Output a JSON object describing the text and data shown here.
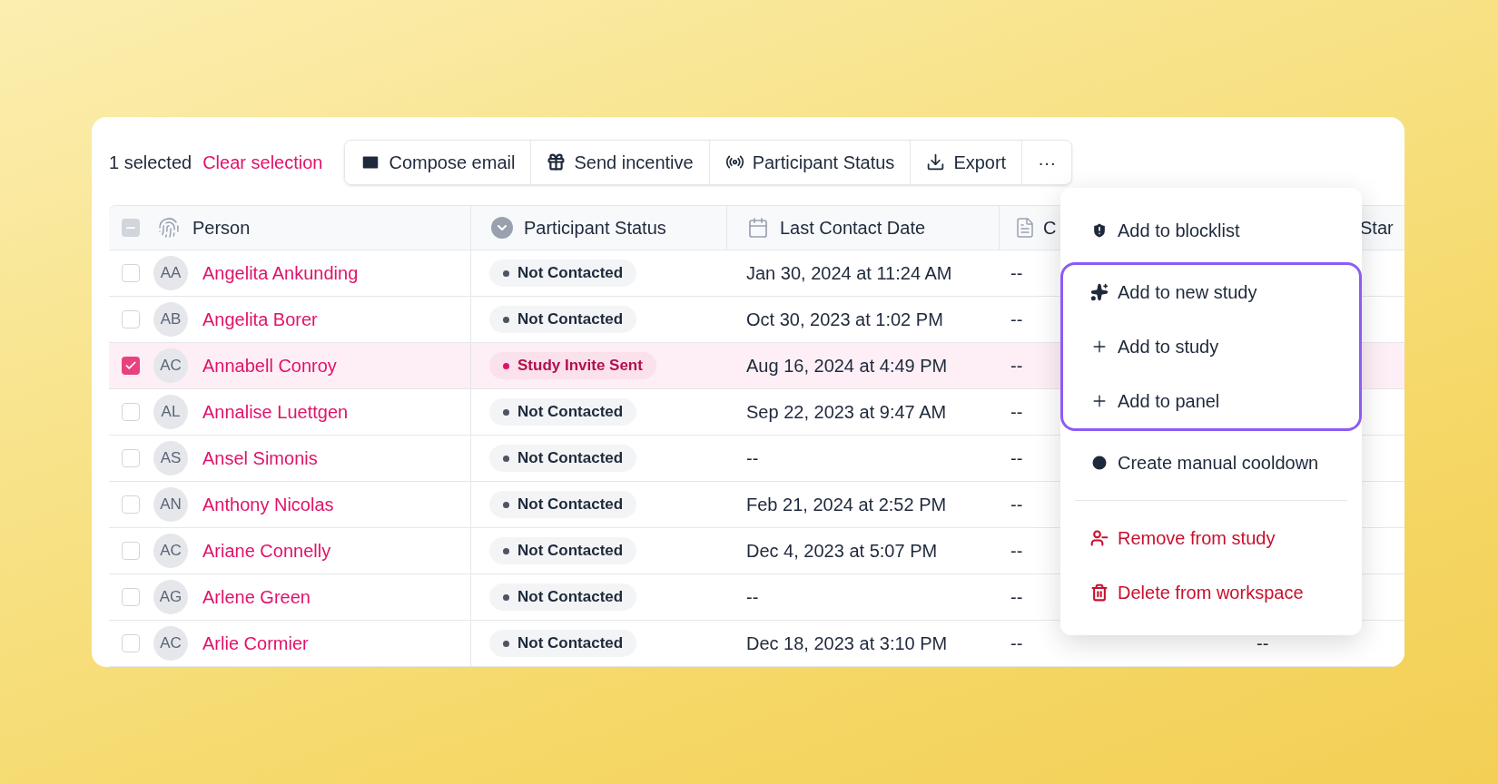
{
  "toolbar": {
    "selection_count": "1 selected",
    "clear_link": "Clear selection",
    "actions": [
      "Compose email",
      "Send incentive",
      "Participant Status",
      "Export",
      "···"
    ]
  },
  "table": {
    "select_all_indeterminate": true,
    "columns": [
      "Person",
      "Participant Status",
      "Last Contact Date",
      "C",
      "Star"
    ],
    "rows": [
      {
        "selected": false,
        "initials": "AA",
        "name": "Angelita Ankunding",
        "status": {
          "label": "Not Contacted",
          "kind": "neutral"
        },
        "last_contact": "Jan 30, 2024 at 11:24 AM",
        "column_5": "--"
      },
      {
        "selected": false,
        "initials": "AB",
        "name": "Angelita Borer",
        "status": {
          "label": "Not Contacted",
          "kind": "neutral"
        },
        "last_contact": "Oct 30, 2023 at 1:02 PM",
        "column_5": "--"
      },
      {
        "selected": true,
        "initials": "AC",
        "name": "Annabell Conroy",
        "status": {
          "label": "Study Invite Sent",
          "kind": "invited"
        },
        "last_contact": "Aug 16, 2024 at 4:49 PM",
        "column_5": "--"
      },
      {
        "selected": false,
        "initials": "AL",
        "name": "Annalise Luettgen",
        "status": {
          "label": "Not Contacted",
          "kind": "neutral"
        },
        "last_contact": "Sep 22, 2023 at 9:47 AM",
        "column_5": "--"
      },
      {
        "selected": false,
        "initials": "AS",
        "name": "Ansel Simonis",
        "status": {
          "label": "Not Contacted",
          "kind": "neutral"
        },
        "last_contact": "--",
        "column_5": "--"
      },
      {
        "selected": false,
        "initials": "AN",
        "name": "Anthony Nicolas",
        "status": {
          "label": "Not Contacted",
          "kind": "neutral"
        },
        "last_contact": "Feb 21, 2024 at 2:52 PM",
        "column_5": "--"
      },
      {
        "selected": false,
        "initials": "AC",
        "name": "Ariane Connelly",
        "status": {
          "label": "Not Contacted",
          "kind": "neutral"
        },
        "last_contact": "Dec 4, 2023 at 5:07 PM",
        "column_5": "--"
      },
      {
        "selected": false,
        "initials": "AG",
        "name": "Arlene Green",
        "status": {
          "label": "Not Contacted",
          "kind": "neutral"
        },
        "last_contact": "--",
        "column_5": "--"
      },
      {
        "selected": false,
        "initials": "AC",
        "name": "Arlie Cormier",
        "status": {
          "label": "Not Contacted",
          "kind": "neutral"
        },
        "last_contact": "Dec 18, 2023 at 3:10 PM",
        "column_5": "--",
        "column_6": "--"
      }
    ]
  },
  "menu": {
    "items_before": [
      "Add to blocklist"
    ],
    "highlighted_items": [
      "Add to new study",
      "Add to study",
      "Add to panel"
    ],
    "items_after": [
      "Create manual cooldown"
    ],
    "danger_items": [
      "Remove from study",
      "Delete from workspace"
    ]
  }
}
